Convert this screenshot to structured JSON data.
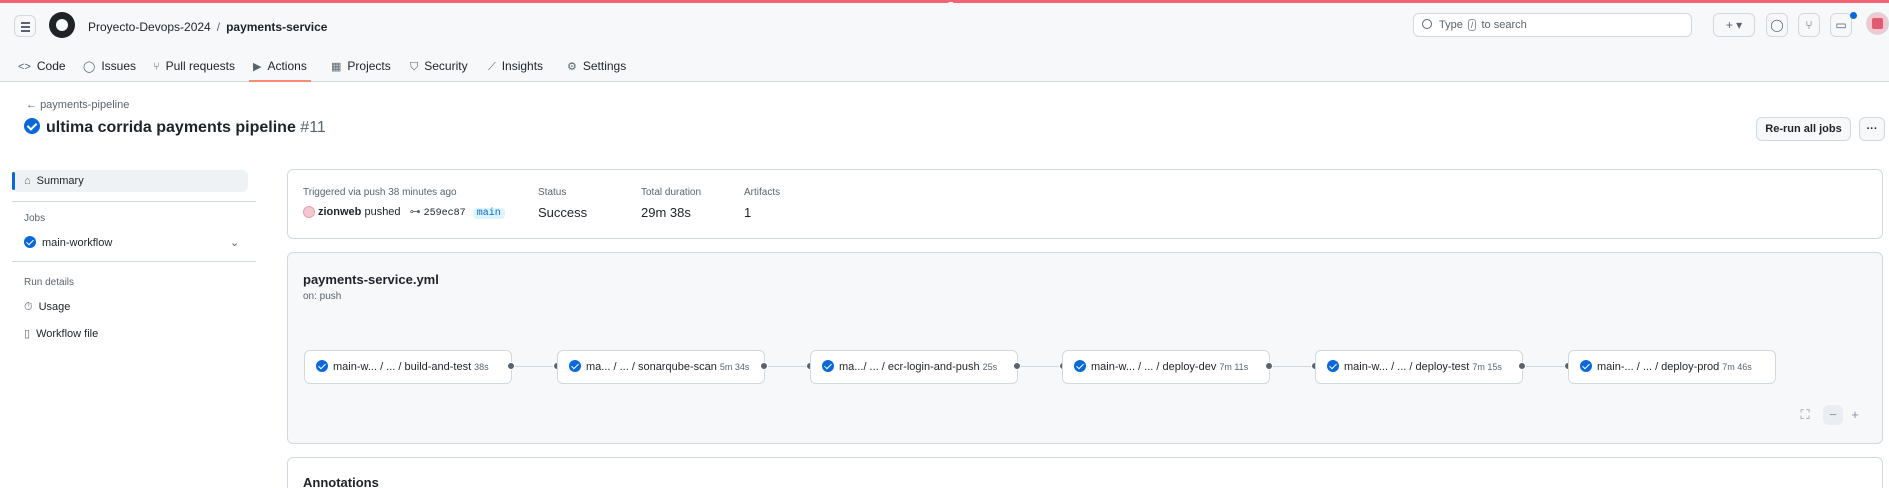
{
  "header": {
    "owner": "Proyecto-Devops-2024",
    "separator": "/",
    "repo": "payments-service",
    "search_prefix": "Type",
    "search_key": "/",
    "search_suffix": "to search",
    "plus_label": "+ ▾"
  },
  "tabs": [
    {
      "label": "Code",
      "icon": "<>"
    },
    {
      "label": "Issues",
      "icon": "◯"
    },
    {
      "label": "Pull requests",
      "icon": "⑂"
    },
    {
      "label": "Actions",
      "icon": "▶"
    },
    {
      "label": "Projects",
      "icon": "▦"
    },
    {
      "label": "Security",
      "icon": "⛉"
    },
    {
      "label": "Insights",
      "icon": "⟋"
    },
    {
      "label": "Settings",
      "icon": "⚙"
    }
  ],
  "run": {
    "back_label": "payments-pipeline",
    "title": "ultima corrida payments pipeline",
    "number": "#11",
    "rerun_label": "Re-run all jobs",
    "more_label": "···"
  },
  "sidebar": {
    "summary": "Summary",
    "jobs_heading": "Jobs",
    "job": "main-workflow",
    "details_heading": "Run details",
    "usage": "Usage",
    "workflow_file": "Workflow file"
  },
  "summary": {
    "trigger": "Triggered via push 38 minutes ago",
    "user": "zionweb",
    "action": "pushed",
    "commit": "259ec87",
    "branch": "main",
    "status_label": "Status",
    "status": "Success",
    "duration_label": "Total duration",
    "duration": "29m 38s",
    "artifacts_label": "Artifacts",
    "artifacts": "1"
  },
  "workflow": {
    "file": "payments-service.yml",
    "trigger": "on: push",
    "jobs": [
      {
        "name": "main-w... / ... / build-and-test",
        "duration": "38s"
      },
      {
        "name": "ma... / ... / sonarqube-scan",
        "duration": "5m 34s"
      },
      {
        "name": "ma.../ ... / ecr-login-and-push",
        "duration": "25s"
      },
      {
        "name": "main-w... / ... / deploy-dev",
        "duration": "7m 11s"
      },
      {
        "name": "main-w... / ... / deploy-test",
        "duration": "7m 15s"
      },
      {
        "name": "main-... / ... / deploy-prod",
        "duration": "7m 46s"
      }
    ],
    "controls": {
      "fullscreen": "⛶",
      "zoom_out": "−",
      "zoom_in": "+"
    }
  },
  "annotations": {
    "title": "Annotations"
  },
  "colors": {
    "accent": "#0969da",
    "tab_underline": "#fd8c73",
    "top_bar": "#f26474"
  }
}
